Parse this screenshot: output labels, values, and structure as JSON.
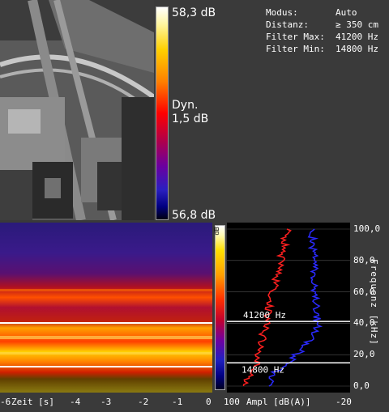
{
  "colorbar": {
    "max_label": "58,3 dB",
    "dyn_label": "Dyn.",
    "dyn_value": "1,5 dB",
    "min_label": "56,8 dB"
  },
  "info": [
    {
      "key": "Modus:",
      "value": "Auto"
    },
    {
      "key": "Distanz:",
      "value": "≥ 350 cm"
    },
    {
      "key": "Filter Max:",
      "value": "41200 Hz"
    },
    {
      "key": "Filter Min:",
      "value": "14800 Hz"
    }
  ],
  "spectrogram": {
    "time_ticks": [
      "-6",
      "-4",
      "-3",
      "-2",
      "-1",
      "0"
    ],
    "time_label": "Zeit [s]",
    "colorbar_unit": "dB"
  },
  "freq_plot": {
    "y_ticks": [
      "100,0",
      "80,0",
      "60,0",
      "40,0",
      "20,0",
      "0,0"
    ],
    "y_title": "Frequenz [kHz]",
    "x_ticks": [
      "100",
      "-20"
    ],
    "x_label": "Ampl [dB(A)]",
    "filter_max_label": "41200 Hz",
    "filter_min_label": "14800 Hz",
    "filter_max_khz": 41.2,
    "filter_min_khz": 14.8,
    "series_colors": {
      "red": "#ff2020",
      "blue": "#2a2aff"
    }
  },
  "colors": {
    "background": "#3a3a3a",
    "filter_line": "#ffffff"
  }
}
